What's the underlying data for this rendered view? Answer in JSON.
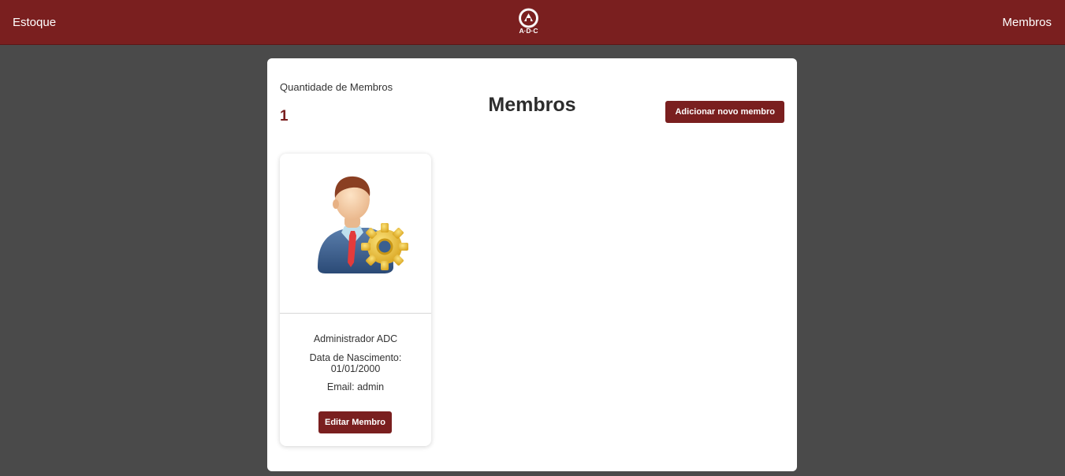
{
  "navbar": {
    "left_link": "Estoque",
    "right_link": "Membros",
    "logo_text": "A·D·C",
    "background": "#7a1f1f"
  },
  "main": {
    "count_label": "Quantidade de Membros",
    "count_value": "1",
    "title": "Membros",
    "add_button": "Adicionar novo membro"
  },
  "members": [
    {
      "avatar_icon": "admin-user-gear-icon",
      "name": "Administrador ADC",
      "dob_label": "Data de Nascimento:",
      "dob": "01/01/2000",
      "email": "Email: admin",
      "edit_button": "Editar Membro"
    }
  ],
  "colors": {
    "accent": "#7a1f1f",
    "page_background": "#4a4a4a",
    "panel_background": "#ffffff"
  }
}
